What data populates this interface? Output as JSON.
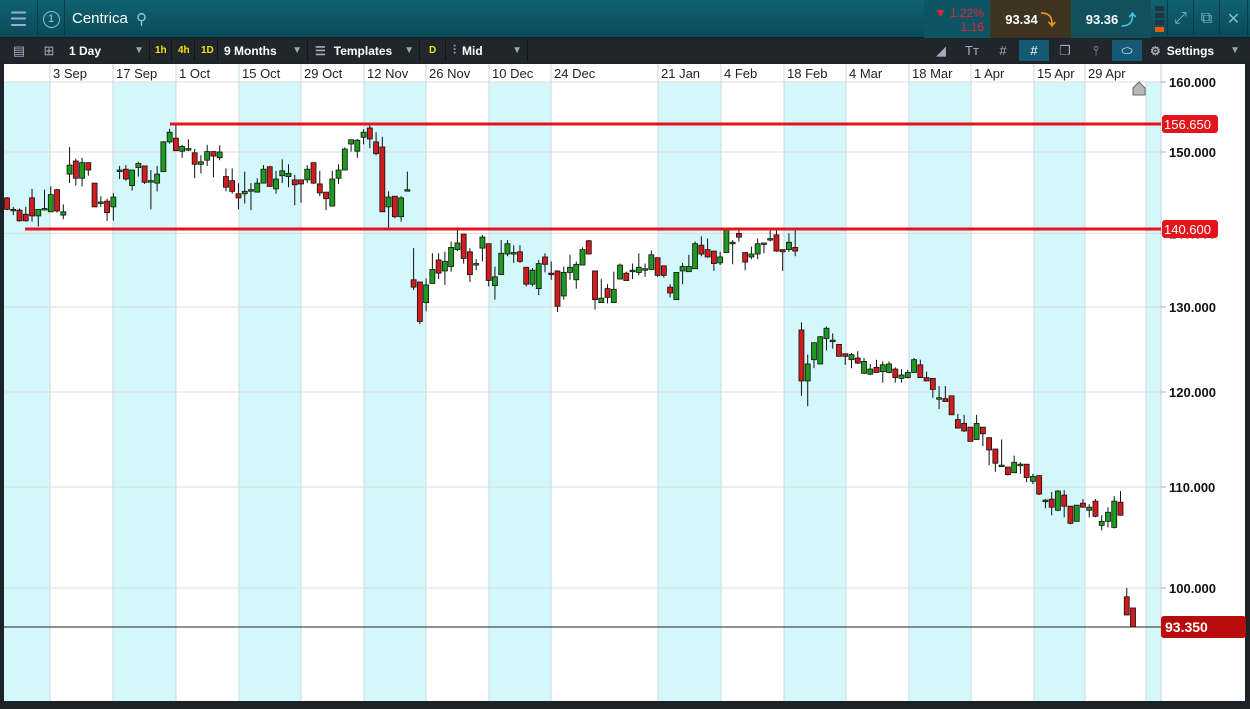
{
  "header": {
    "instrument": "Centrica",
    "change_pct": "▼ 1.22%",
    "change_abs": "1.16",
    "sell_price": "93.34",
    "buy_price": "93.36"
  },
  "toolbar": {
    "interval": "1 Day",
    "quick": [
      "1h",
      "4h",
      "1D"
    ],
    "range": "9 Months",
    "templates": "Templates",
    "d_label": "D",
    "price_type": "Mid",
    "settings": "Settings"
  },
  "colors": {
    "up": "#1e9a1e",
    "down": "#d01c1c",
    "band": "#d4f7fb",
    "level_line": "#e5141c",
    "current": "#b80c0c"
  },
  "chart_data": {
    "type": "candlestick",
    "title": "Centrica",
    "xlabels": [
      "3 Sep",
      "17 Sep",
      "1 Oct",
      "15 Oct",
      "29 Oct",
      "12 Nov",
      "26 Nov",
      "10 Dec",
      "24 Dec",
      "21 Jan",
      "4 Feb",
      "18 Feb",
      "4 Mar",
      "18 Mar",
      "1 Apr",
      "15 Apr",
      "29 Apr"
    ],
    "yticks": [
      {
        "value": 160,
        "label": "160.000"
      },
      {
        "value": 150,
        "label": "150.000"
      },
      {
        "value": 140,
        "label": "140.000"
      },
      {
        "value": 130,
        "label": "130.000"
      },
      {
        "value": 120,
        "label": "120.000"
      },
      {
        "value": 110,
        "label": "110.000"
      },
      {
        "value": 100,
        "label": "100.000"
      }
    ],
    "levels": [
      {
        "value": 156.65,
        "label": "156.650"
      },
      {
        "value": 140.6,
        "label": "140.600"
      }
    ],
    "current": {
      "value": 93.35,
      "label": "93.350"
    },
    "ohlc_format": [
      "open",
      "high",
      "low",
      "close"
    ],
    "candles": [
      [
        144.4,
        144.5,
        142.9,
        143.0
      ],
      [
        143.0,
        143.3,
        142.3,
        143.0
      ],
      [
        142.9,
        143.1,
        141.5,
        141.6
      ],
      [
        142.4,
        143.3,
        141.5,
        141.6
      ],
      [
        144.4,
        145.5,
        141.5,
        142.2
      ],
      [
        142.2,
        143.0,
        140.9,
        143.0
      ],
      [
        143.0,
        145.4,
        142.9,
        143.1
      ],
      [
        142.7,
        145.8,
        142.7,
        144.8
      ],
      [
        145.4,
        145.5,
        142.6,
        142.8
      ],
      [
        142.3,
        143.6,
        141.8,
        142.7
      ],
      [
        147.3,
        151.2,
        146.2,
        148.4
      ],
      [
        148.9,
        149.2,
        145.9,
        146.8
      ],
      [
        146.8,
        149.3,
        145.8,
        148.7
      ],
      [
        148.7,
        148.7,
        147.1,
        147.8
      ],
      [
        146.2,
        146.2,
        143.3,
        143.3
      ],
      [
        143.9,
        144.6,
        143.3,
        143.9
      ],
      [
        144.0,
        144.3,
        141.6,
        142.6
      ],
      [
        143.3,
        145.0,
        141.6,
        144.5
      ],
      [
        147.7,
        148.3,
        146.7,
        147.8
      ],
      [
        147.9,
        148.4,
        146.5,
        146.7
      ],
      [
        145.9,
        147.8,
        145.3,
        147.8
      ],
      [
        148.1,
        148.8,
        147.0,
        148.6
      ],
      [
        148.3,
        148.3,
        146.1,
        146.3
      ],
      [
        146.4,
        147.8,
        143.0,
        146.5
      ],
      [
        146.2,
        148.3,
        145.2,
        147.3
      ],
      [
        147.6,
        152.6,
        147.6,
        152.4
      ],
      [
        152.4,
        155.5,
        152.0,
        154.7
      ],
      [
        153.3,
        156.6,
        150.3,
        150.3
      ],
      [
        150.2,
        151.7,
        149.3,
        151.3
      ],
      [
        150.8,
        153.0,
        150.2,
        150.8
      ],
      [
        149.9,
        150.7,
        146.8,
        148.5
      ],
      [
        148.5,
        149.6,
        147.4,
        148.8
      ],
      [
        149.0,
        151.7,
        148.3,
        150.1
      ],
      [
        150.1,
        150.1,
        146.9,
        149.5
      ],
      [
        149.3,
        151.6,
        149.0,
        150.0
      ],
      [
        147.0,
        148.0,
        145.2,
        145.7
      ],
      [
        146.5,
        148.0,
        144.9,
        145.2
      ],
      [
        144.9,
        146.2,
        143.0,
        144.4
      ],
      [
        144.9,
        147.6,
        143.7,
        145.2
      ],
      [
        145.4,
        146.2,
        142.9,
        145.4
      ],
      [
        145.1,
        146.8,
        145.1,
        146.2
      ],
      [
        146.2,
        148.4,
        146.2,
        147.9
      ],
      [
        148.2,
        148.3,
        145.8,
        145.8
      ],
      [
        145.5,
        147.7,
        144.9,
        146.7
      ],
      [
        147.1,
        149.1,
        146.2,
        147.7
      ],
      [
        147.0,
        148.5,
        145.7,
        147.4
      ],
      [
        146.6,
        147.2,
        143.5,
        146.0
      ],
      [
        146.6,
        146.6,
        143.8,
        146.1
      ],
      [
        146.6,
        148.4,
        146.2,
        147.9
      ],
      [
        148.7,
        148.7,
        146.1,
        146.2
      ],
      [
        146.1,
        147.7,
        144.6,
        145.0
      ],
      [
        145.1,
        145.1,
        142.9,
        144.3
      ],
      [
        143.4,
        147.7,
        143.4,
        146.7
      ],
      [
        146.8,
        148.5,
        146.1,
        147.8
      ],
      [
        147.8,
        151.1,
        147.8,
        150.7
      ],
      [
        151.9,
        153.0,
        150.1,
        152.9
      ],
      [
        150.2,
        153.1,
        149.3,
        152.8
      ],
      [
        153.5,
        155.4,
        151.8,
        154.7
      ],
      [
        155.7,
        156.5,
        150.9,
        153.1
      ],
      [
        152.4,
        154.7,
        149.6,
        149.8
      ],
      [
        151.2,
        153.6,
        142.7,
        142.7
      ],
      [
        143.3,
        145.2,
        140.6,
        144.5
      ],
      [
        144.6,
        144.6,
        141.9,
        142.1
      ],
      [
        142.1,
        144.6,
        141.5,
        144.4
      ],
      [
        145.4,
        147.6,
        145.2,
        145.4
      ],
      [
        133.7,
        138.0,
        132.3,
        132.7
      ],
      [
        133.4,
        133.4,
        128.0,
        128.3
      ],
      [
        130.6,
        133.9,
        129.5,
        133.0
      ],
      [
        133.2,
        137.3,
        133.2,
        135.1
      ],
      [
        136.4,
        137.3,
        133.8,
        134.6
      ],
      [
        134.9,
        137.5,
        133.0,
        136.2
      ],
      [
        135.5,
        138.9,
        134.8,
        138.1
      ],
      [
        137.8,
        140.8,
        137.6,
        138.7
      ],
      [
        139.9,
        139.9,
        135.9,
        136.6
      ],
      [
        137.5,
        138.0,
        133.4,
        134.4
      ],
      [
        135.9,
        136.5,
        135.0,
        135.9
      ],
      [
        138.0,
        139.8,
        136.2,
        139.5
      ],
      [
        138.6,
        138.6,
        132.8,
        133.6
      ],
      [
        132.9,
        135.5,
        131.0,
        134.1
      ],
      [
        134.4,
        139.1,
        134.4,
        137.3
      ],
      [
        137.2,
        139.1,
        136.9,
        138.6
      ],
      [
        137.4,
        138.4,
        136.0,
        137.4
      ],
      [
        137.5,
        138.4,
        136.0,
        136.2
      ],
      [
        135.4,
        135.4,
        132.8,
        133.1
      ],
      [
        133.1,
        135.3,
        132.8,
        135.0
      ],
      [
        132.5,
        136.4,
        131.6,
        135.9
      ],
      [
        136.8,
        137.3,
        134.7,
        135.8
      ],
      [
        134.6,
        136.2,
        133.7,
        134.5
      ],
      [
        134.9,
        135.0,
        129.4,
        130.1
      ],
      [
        131.5,
        135.5,
        131.0,
        134.7
      ],
      [
        134.7,
        137.1,
        133.7,
        135.4
      ],
      [
        133.7,
        136.2,
        132.5,
        135.8
      ],
      [
        135.7,
        138.1,
        135.7,
        137.8
      ],
      [
        139.0,
        139.1,
        137.2,
        137.2
      ],
      [
        134.9,
        134.9,
        129.7,
        131.0
      ],
      [
        130.6,
        133.8,
        130.6,
        131.2
      ],
      [
        132.5,
        133.1,
        130.5,
        131.3
      ],
      [
        130.6,
        134.8,
        130.6,
        132.4
      ],
      [
        133.8,
        135.9,
        133.8,
        135.7
      ],
      [
        134.6,
        134.8,
        133.6,
        133.6
      ],
      [
        135.0,
        135.9,
        133.8,
        135.0
      ],
      [
        134.7,
        137.3,
        134.3,
        135.4
      ],
      [
        135.2,
        135.9,
        134.1,
        135.2
      ],
      [
        135.1,
        137.7,
        135.1,
        137.1
      ],
      [
        136.7,
        136.7,
        134.1,
        134.3
      ],
      [
        135.6,
        135.6,
        134.0,
        134.3
      ],
      [
        132.7,
        133.1,
        131.3,
        131.9
      ],
      [
        131.0,
        134.7,
        131.0,
        134.7
      ],
      [
        134.9,
        136.0,
        133.1,
        135.5
      ],
      [
        134.8,
        137.1,
        134.8,
        135.5
      ],
      [
        135.2,
        138.9,
        135.2,
        138.6
      ],
      [
        138.4,
        139.6,
        136.9,
        137.2
      ],
      [
        137.8,
        139.3,
        136.7,
        136.8
      ],
      [
        137.6,
        137.6,
        134.9,
        135.9
      ],
      [
        136.0,
        137.5,
        135.7,
        136.8
      ],
      [
        137.4,
        140.7,
        137.4,
        140.5
      ],
      [
        138.8,
        139.1,
        135.8,
        138.8
      ],
      [
        140.0,
        140.5,
        138.9,
        139.5
      ],
      [
        137.4,
        137.4,
        135.0,
        136.1
      ],
      [
        136.8,
        138.2,
        136.5,
        137.2
      ],
      [
        137.2,
        139.3,
        136.5,
        138.6
      ],
      [
        138.7,
        138.7,
        137.3,
        138.7
      ],
      [
        139.3,
        140.5,
        138.9,
        139.3
      ],
      [
        139.8,
        140.5,
        137.5,
        137.6
      ],
      [
        137.8,
        137.8,
        134.9,
        137.5
      ],
      [
        137.8,
        140.0,
        137.5,
        138.8
      ],
      [
        138.1,
        140.7,
        136.9,
        137.6
      ],
      [
        127.3,
        128.2,
        119.6,
        121.3
      ],
      [
        121.3,
        124.4,
        118.5,
        123.3
      ],
      [
        123.8,
        125.8,
        122.8,
        125.8
      ],
      [
        123.3,
        126.6,
        123.3,
        126.5
      ],
      [
        126.3,
        127.7,
        124.9,
        127.5
      ],
      [
        126.1,
        126.9,
        125.1,
        126.1
      ],
      [
        125.6,
        125.6,
        124.2,
        124.2
      ],
      [
        124.5,
        124.5,
        123.2,
        124.2
      ],
      [
        123.8,
        124.6,
        122.8,
        124.4
      ],
      [
        124.0,
        124.8,
        123.3,
        123.4
      ],
      [
        122.2,
        124.0,
        122.1,
        123.6
      ],
      [
        122.1,
        123.3,
        122.0,
        122.7
      ],
      [
        122.9,
        123.8,
        122.3,
        122.3
      ],
      [
        122.4,
        123.6,
        121.1,
        123.2
      ],
      [
        122.3,
        123.6,
        122.2,
        123.3
      ],
      [
        122.7,
        122.9,
        121.1,
        121.7
      ],
      [
        121.6,
        122.7,
        121.1,
        122.0
      ],
      [
        121.7,
        122.6,
        121.6,
        122.3
      ],
      [
        122.3,
        124.0,
        122.3,
        123.8
      ],
      [
        123.2,
        123.8,
        121.7,
        121.7
      ],
      [
        121.7,
        122.4,
        121.3,
        121.3
      ],
      [
        121.6,
        121.6,
        119.4,
        120.3
      ],
      [
        119.4,
        120.7,
        118.2,
        119.4
      ],
      [
        119.3,
        120.7,
        119.0,
        119.0
      ],
      [
        119.6,
        119.6,
        117.6,
        117.6
      ],
      [
        117.1,
        117.7,
        116.2,
        116.2
      ],
      [
        116.7,
        117.6,
        115.8,
        115.9
      ],
      [
        116.3,
        116.3,
        114.8,
        114.8
      ],
      [
        115.0,
        117.6,
        115.0,
        116.7
      ],
      [
        116.3,
        116.3,
        114.3,
        115.6
      ],
      [
        115.2,
        115.2,
        112.3,
        113.9
      ],
      [
        114.0,
        114.0,
        111.6,
        112.5
      ],
      [
        112.3,
        115.0,
        112.1,
        112.3
      ],
      [
        112.1,
        112.1,
        111.2,
        111.3
      ],
      [
        111.5,
        113.3,
        111.5,
        112.6
      ],
      [
        112.4,
        112.6,
        111.4,
        112.4
      ],
      [
        112.4,
        112.4,
        110.5,
        111.0
      ],
      [
        110.6,
        111.4,
        110.3,
        111.1
      ],
      [
        111.2,
        111.2,
        109.2,
        109.3
      ],
      [
        108.7,
        108.8,
        107.9,
        108.7
      ],
      [
        108.8,
        109.5,
        107.2,
        108.0
      ],
      [
        107.7,
        109.7,
        107.6,
        109.6
      ],
      [
        109.2,
        109.7,
        107.0,
        108.1
      ],
      [
        108.1,
        108.1,
        106.3,
        106.4
      ],
      [
        106.6,
        108.2,
        106.6,
        108.2
      ],
      [
        108.4,
        108.8,
        108.0,
        108.0
      ],
      [
        107.7,
        108.3,
        107.0,
        108.0
      ],
      [
        108.6,
        108.8,
        107.0,
        107.1
      ],
      [
        106.2,
        107.2,
        105.7,
        106.6
      ],
      [
        106.6,
        108.0,
        106.0,
        107.5
      ],
      [
        106.0,
        109.1,
        105.9,
        108.6
      ],
      [
        108.5,
        109.6,
        107.2,
        107.2
      ],
      [
        98.5,
        100.0,
        95.4,
        95.4
      ],
      [
        96.6,
        96.6,
        93.35,
        93.35
      ]
    ]
  }
}
